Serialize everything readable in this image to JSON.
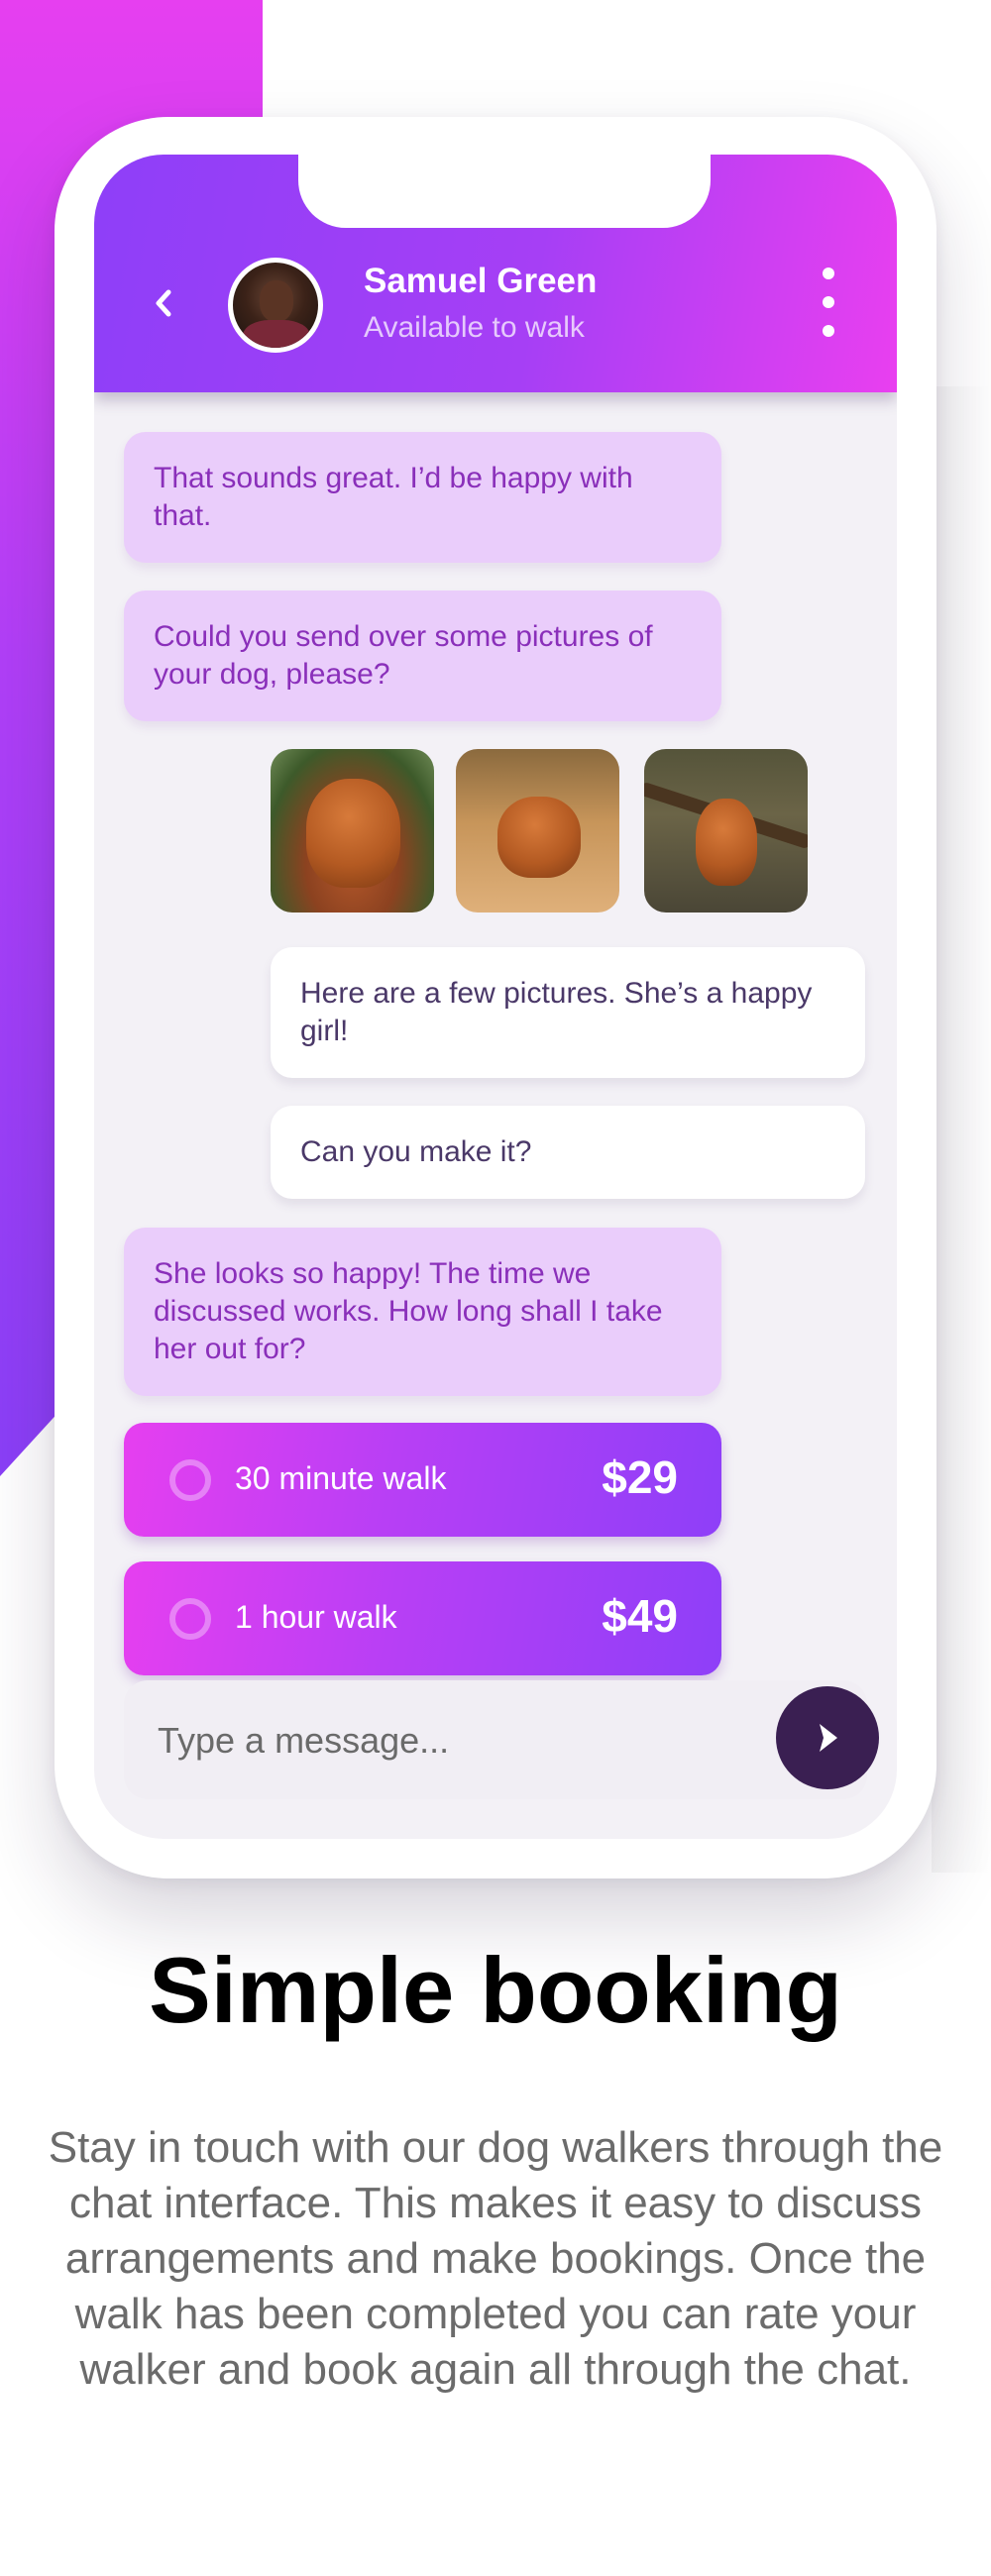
{
  "header": {
    "contact_name": "Samuel Green",
    "contact_status": "Available to walk",
    "back_icon": "chevron-left-icon",
    "menu_icon": "more-vertical-icon"
  },
  "messages": [
    {
      "from": "walker",
      "text": "That sounds great. I’d be happy with that."
    },
    {
      "from": "walker",
      "text": "Could you send over some pictures of your dog, please?"
    },
    {
      "from": "owner",
      "text": "Here are a few pictures. She’s a happy girl!"
    },
    {
      "from": "owner",
      "text": "Can you make it?"
    },
    {
      "from": "walker",
      "text": "She looks so happy! The time we discussed works. How long shall I take her out for?"
    }
  ],
  "photos": [
    "dog-photo-1",
    "dog-photo-2",
    "dog-photo-3"
  ],
  "options": [
    {
      "label": "30 minute walk",
      "price": "$29",
      "selected": false
    },
    {
      "label": "1 hour walk",
      "price": "$49",
      "selected": false
    }
  ],
  "composer": {
    "placeholder": "Type a message...",
    "send_icon": "send-arrow-icon"
  },
  "marketing": {
    "title": "Simple booking",
    "description": "Stay in touch with our dog walkers through the chat interface. This makes it easy to discuss arrangements and make bookings. Once the walk has been completed you can rate your walker and book again all through the chat."
  },
  "colors": {
    "accent_magenta": "#e63ff0",
    "accent_purple": "#8e3ff8",
    "bubble_in": "#eacdfb",
    "bubble_in_text": "#8a2fba",
    "send_button": "#3a1f52"
  }
}
